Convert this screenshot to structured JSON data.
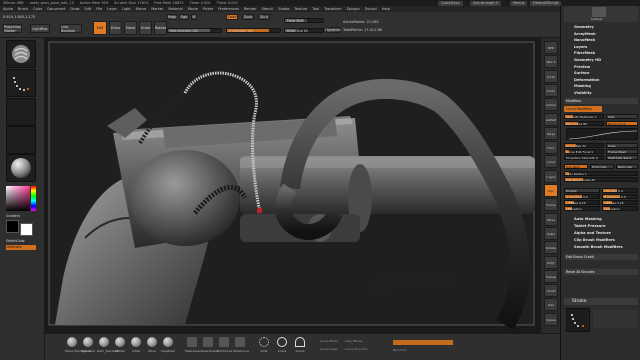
{
  "titlebar": {
    "items": [
      "ZBrush 4R8",
      "ready guns_pose_edit_15",
      "Active Mem 919",
      "Scratch Disk 17674",
      "Free Mem 16872",
      "Timer 0.001",
      "Timer 0.001"
    ],
    "quicksave": "QuickSave",
    "seethrough": "See-through 0",
    "menus": "Menus",
    "defaultscript": "DefaultZScript"
  },
  "menubar": {
    "items": [
      "Alpha",
      "Brush",
      "Color",
      "Document",
      "Draw",
      "Edit",
      "File",
      "Layer",
      "Light",
      "Macro",
      "Marker",
      "Material",
      "Movie",
      "Picker",
      "Preferences",
      "Render",
      "Stencil",
      "Stroke",
      "Texture",
      "Tool",
      "Transform",
      "Zplugin",
      "Zscript",
      "Help"
    ]
  },
  "topshelf": {
    "stat": "0.619,1.803,1.175",
    "projection_master": "Projection Master",
    "lightbox": "LightBox",
    "live_boolean": "Live Boolean",
    "edit": "Edit",
    "draw": "Draw",
    "move": "Move",
    "scale": "Scale",
    "rotate": "Rotate",
    "mrgb": "Mrgb",
    "rgb": "Rgb",
    "m": "M",
    "zadd": "Zadd",
    "zsub": "Zsub",
    "zcut": "Zcut",
    "rgb_intensity": "Rgb Intensity 100",
    "z_intensity": "Z Intensity 100",
    "focal_shift": "Focal Shift 0",
    "draw_size": "Draw Size 64",
    "dynamic": "Dynamic",
    "active_points": "ActivePoints: 21,082",
    "total_points": "TotalPoints: 17.411 Mil"
  },
  "leftshelf": {
    "gradient_label": "Gradient",
    "switch_color": "SwitchColor",
    "alternate": "Alternate"
  },
  "rightshelf": {
    "buttons": [
      "BPR",
      "SPix 3",
      "Scroll",
      "Zoom",
      "Actual",
      "AAHalf",
      "Persp",
      "Floor",
      "Local",
      "L.Sym",
      "Xyz",
      "Frame",
      "Move",
      "Scale",
      "Rotate",
      "PolyF",
      "Transp",
      "Ghost",
      "Solo",
      "Xpose"
    ]
  },
  "bottomshelf": {
    "brushes": [
      "Move Topological",
      "Standard",
      "Dam_Standard",
      "hPolish",
      "Inflat",
      "Move",
      "ClayBuild"
    ],
    "masks": [
      "MaskLasso",
      "SelectLasso",
      "TrimCurve",
      "SliceCurve"
    ],
    "strokes": [
      "Dots",
      "Circle",
      "Curve"
    ],
    "dots": [
      "Curve Mode",
      "Curve Snap",
      "Lazy Mouse",
      "Curve Function",
      "Bend Arc"
    ]
  },
  "tray": {
    "tabs": [
      "Subtool",
      "Geometry",
      "Layers"
    ],
    "rows": [
      "Geometry",
      "ArrayMesh",
      "NanoMesh",
      "Layers",
      "FiberMesh",
      "Geometry HD",
      "Preview",
      "Surface",
      "Deformation",
      "Masking",
      "Visibility"
    ],
    "modifiers_title": "Modifiers",
    "curve_modifiers": "Curve Modifiers",
    "strength_multiplier": "Strength Multiplier 1",
    "max_points": "Max Points 80",
    "size": "Size",
    "bend_curve": "Bend Curve",
    "curve_res": "Curve Res 32",
    "curve_edit_focal": "Curve Edit Focal 5",
    "projection_strength": "Projection Strength 0",
    "snap": "Snap",
    "frame_mesh": "Frame Mesh",
    "multitube_stack": "MultiTube Stack",
    "sub_parts": "Sub Parts",
    "front_cap": "Front Cap",
    "back_cap": "Back Cap",
    "lazy_radius": "Lazy Radius 1",
    "max_bend_angle": "Max Bend Angle 45",
    "double": "Double",
    "intensity": "Intensity 0.4",
    "apertureA": "A Aperture 0.5",
    "apertureB": "B Aperture 0.5",
    "liftbaseA": "LiftBase 0.25",
    "liftbaseB": "LiftBase 0.25",
    "elevationA": "LElevation",
    "elevationB": "LElevation",
    "menu_items": [
      "Auto Masking",
      "Tablet Pressure",
      "Alpha and Texture",
      "Clip Brush Modifiers",
      "Smooth Brush Modifiers"
    ],
    "edit_brush_credit": "Edit Brush Credit",
    "reset_all_brushes": "Reset All Brushes",
    "stroke_title": "Stroke"
  },
  "colors": {
    "accent": "#e07c24",
    "bg": "#2b2b2b",
    "viewport": "#1a1a1a"
  }
}
